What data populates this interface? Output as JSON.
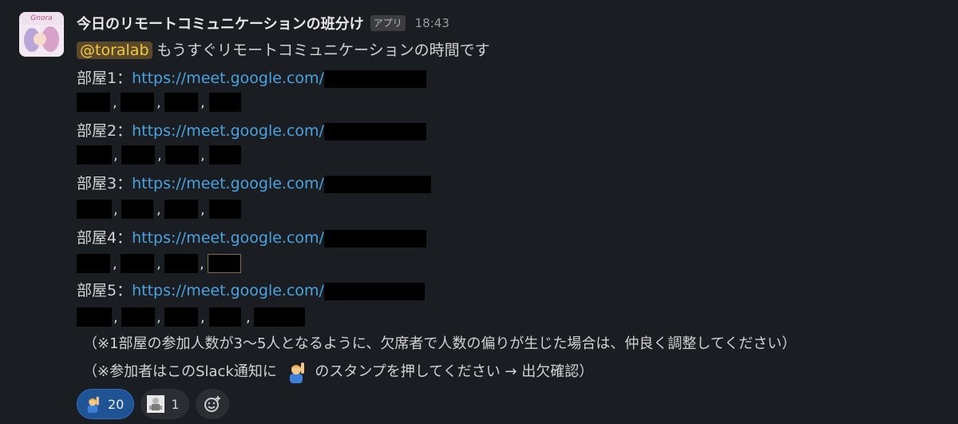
{
  "message": {
    "app_name": "今日のリモートコミュニケーションの班分け",
    "app_badge": "アプリ",
    "time": "18:43",
    "avatar_text": "Gnora",
    "mention": "@toralab",
    "intro": " もうすぐリモートコミュニケーションの時間です",
    "rooms": [
      {
        "label": "部屋1：",
        "url": "https://meet.google.com/"
      },
      {
        "label": "部屋2：",
        "url": "https://meet.google.com/"
      },
      {
        "label": "部屋3：",
        "url": "https://meet.google.com/"
      },
      {
        "label": "部屋4：",
        "url": "https://meet.google.com/"
      },
      {
        "label": "部屋5：",
        "url": "https://meet.google.com/"
      }
    ],
    "name_separator": ",",
    "note1": "（※1部屋の参加人数が3〜5人となるように、欠席者で人数の偏りが生じた場合は、仲良く調整してください）",
    "note2_before": "（※参加者はこのSlack通知に",
    "note2_after": "のスタンプを押してください → 出欠確認）",
    "note2_emoji": "raising-hand-emoji"
  },
  "reactions": [
    {
      "emoji": "raising-hand-emoji",
      "count": "20",
      "active": true
    },
    {
      "emoji": "custom-sticker-emoji",
      "count": "1",
      "active": false
    }
  ],
  "colors": {
    "background": "#1a1d21",
    "link": "#4aa3df",
    "mention_text": "#f2c744",
    "mention_bg": "#5b4a2a",
    "active_reaction": "#1f5394"
  }
}
